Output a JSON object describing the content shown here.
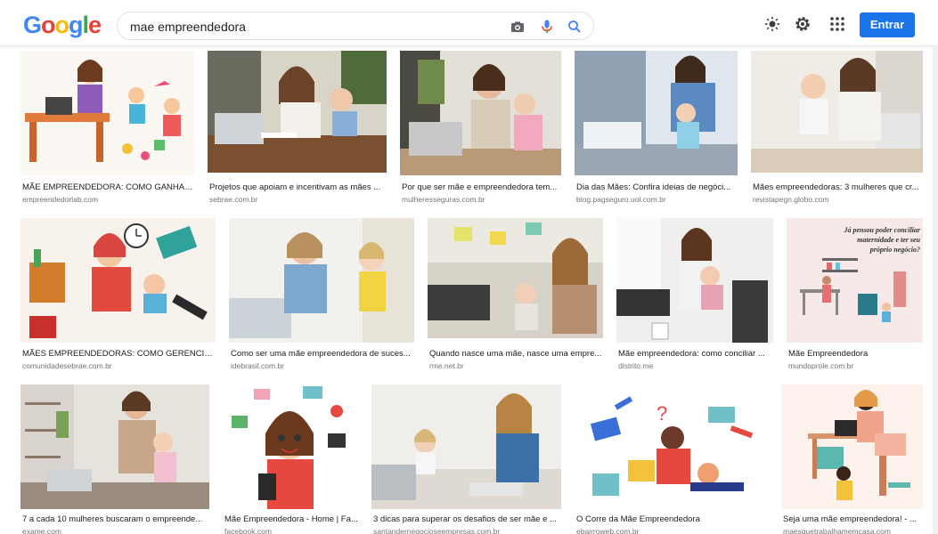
{
  "header": {
    "logo": "Google",
    "search_query": "mae empreendedora",
    "signin_label": "Entrar",
    "icons": [
      "camera-icon",
      "microphone-icon",
      "search-icon",
      "brightness-icon",
      "settings-icon",
      "apps-icon"
    ]
  },
  "colors": {
    "accent": "#1a73e8",
    "logo": [
      "#4285F4",
      "#EA4335",
      "#FBBC05",
      "#4285F4",
      "#34A853",
      "#EA4335"
    ]
  },
  "results": [
    {
      "title": "MÃE EMPREENDEDORA: COMO GANHAR ...",
      "source": "empreendedorlab.com"
    },
    {
      "title": "Projetos que apoiam e incentivam as mães ...",
      "source": "sebrae.com.br"
    },
    {
      "title": "Por que ser mãe e empreendedora tem...",
      "source": "mulheresseguras.com.br"
    },
    {
      "title": "Dia das Mães: Confira ideias de negóci...",
      "source": "blog.pagseguro.uol.com.br"
    },
    {
      "title": "Mães empreendedoras: 3 mulheres que cr...",
      "source": "revistapegn.globo.com"
    },
    {
      "title": "MÃES EMPREENDEDORAS: COMO GERENCIAR ...",
      "source": "comunidadesebrae.com.br"
    },
    {
      "title": "Como ser uma mãe empreendedora de suces...",
      "source": "idebrasil.com.br"
    },
    {
      "title": "Quando nasce uma mãe, nasce uma empre...",
      "source": "rme.net.br"
    },
    {
      "title": "Mãe empreendedora: como conciliar ...",
      "source": "distrito.me"
    },
    {
      "title": "Mãe Empreendedora",
      "source": "mundoprole.com.br",
      "image_text": "Já pensou poder conciliar maternidade e ter seu próprio negócio?"
    },
    {
      "title": "7 a cada 10 mulheres buscaram o empreende...",
      "source": "exame.com"
    },
    {
      "title": "Mãe Empreendedora - Home | Fa...",
      "source": "facebook.com"
    },
    {
      "title": "3 dicas para superar os desafios de ser mãe e ...",
      "source": "santandernegocioseempresas.com.br"
    },
    {
      "title": "O Corre da Mãe Empreendedora",
      "source": "ebairroweb.com.br"
    },
    {
      "title": "Seja uma mãe empreendedora! - ...",
      "source": "maesquetrabalhamemcasa.com"
    }
  ]
}
